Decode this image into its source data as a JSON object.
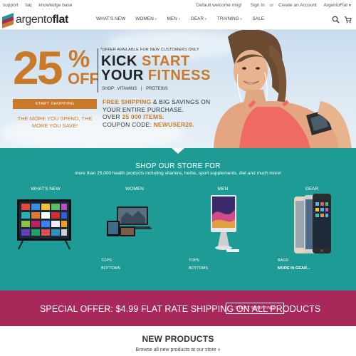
{
  "topbar": {
    "left_links": [
      "support",
      "faq",
      "knowledge base"
    ],
    "welcome": "Default welcome msg!",
    "sign_in": "Sign In",
    "or": "or",
    "create_account": "Create an Account",
    "store_switcher": "ArgentoFlat"
  },
  "header": {
    "logo_light": "argento",
    "logo_bold": "flat",
    "nav": [
      {
        "label": "WHAT'S NEW",
        "dropdown": false
      },
      {
        "label": "WOMEN",
        "dropdown": true
      },
      {
        "label": "MEN",
        "dropdown": true
      },
      {
        "label": "GEAR",
        "dropdown": true
      },
      {
        "label": "TRAINING",
        "dropdown": true
      },
      {
        "label": "SALE",
        "dropdown": false
      }
    ],
    "icons": [
      "search-icon",
      "cart-icon"
    ]
  },
  "hero": {
    "discount_number": "25",
    "discount_symbol": "%",
    "discount_off": "OFF",
    "offer_note": "*OFFER AVAILABLE FOR NEW CUSTOMERS ONLY",
    "headline_1a": "KICK ",
    "headline_1b": "START",
    "headline_2a": "YOUR ",
    "headline_2b": "FITNESS",
    "shop_label": "SHOP:",
    "shop_vitamins": "VITAMINS",
    "shop_sep": "|",
    "shop_proteins": "PROTEINS",
    "button": "START SHOPPING",
    "tagline": "THE MORE YOU SPEND, THE MORE YOU SAVE!",
    "promo_line1_acc": "FREE SHIPPING",
    "promo_line1_rest": " & BIG SAVINGS ON",
    "promo_line2": "YOUR ENTIRE PURCHASE.",
    "promo_line3_pre": "OVER ",
    "promo_line3_acc": "25 000 ITEMS.",
    "promo_line4_pre": "COUPON CODE: ",
    "promo_line4_acc": "NEWUSER20."
  },
  "shop_store": {
    "title": "SHOP OUR STORE FOR",
    "subtitle": "more than 25,000 health products including vitamins, herbs, sport supplements, diet and much more!",
    "categories": [
      {
        "label": "WHAT'S NEW",
        "links": []
      },
      {
        "label": "WOMEN",
        "links": [
          "TOPS",
          "BOTTOMS"
        ]
      },
      {
        "label": "MEN",
        "links": [
          "TOPS",
          "BOTTOMS"
        ]
      },
      {
        "label": "GEAR",
        "links": [
          "BAGS",
          "MORE IN GEAR..."
        ]
      }
    ]
  },
  "special": {
    "text": "SPECIAL OFFER: $4.99 FLAT RATE SHIPPING ON ALL PRODUCTS",
    "button": "START SHOPPING"
  },
  "new_products": {
    "title": "NEW PRODUCTS",
    "subtitle": "Browse all new products at our store »"
  },
  "colors": {
    "accent_orange": "#c87a2a",
    "teal": "#1e9b95",
    "magenta": "#a8285a"
  }
}
